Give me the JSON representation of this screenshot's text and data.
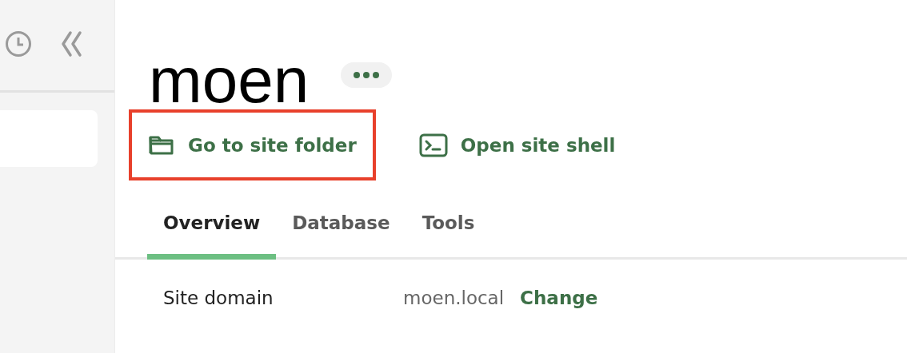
{
  "site": {
    "name": "moen"
  },
  "actions": [
    {
      "kind": "folder",
      "label": "Go to site folder",
      "highlighted": true
    },
    {
      "kind": "shell",
      "label": "Open site shell",
      "highlighted": false
    }
  ],
  "tabs": [
    {
      "label": "Overview",
      "selected": true
    },
    {
      "label": "Database",
      "selected": false
    },
    {
      "label": "Tools",
      "selected": false
    }
  ],
  "rows": [
    {
      "label": "Site domain",
      "value": "moen.local",
      "action": "Change"
    }
  ]
}
